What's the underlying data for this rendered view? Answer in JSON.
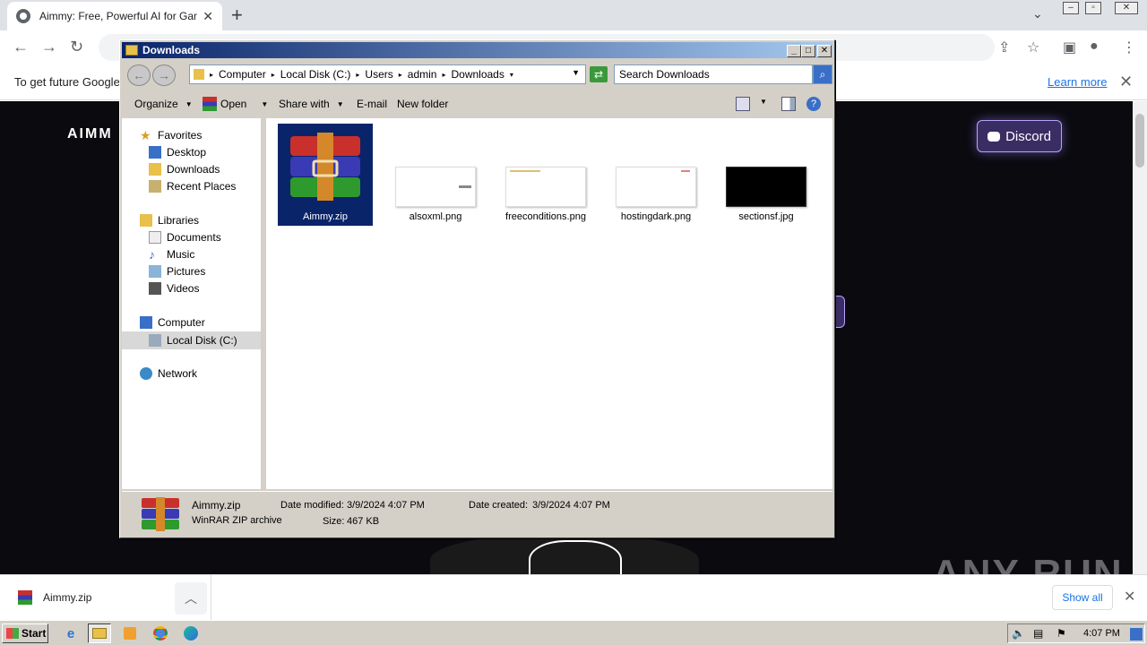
{
  "browser": {
    "tab_title": "Aimmy: Free, Powerful AI for Gaming",
    "infobar_text": "To get future Google",
    "learn_more": "Learn more"
  },
  "webpage": {
    "logo": "AIMM",
    "discord_label": "Discord",
    "watermark": "ANY RUN"
  },
  "download_shelf": {
    "file_name": "Aimmy.zip",
    "show_all": "Show all"
  },
  "taskbar": {
    "start_label": "Start",
    "clock": "4:07 PM"
  },
  "explorer": {
    "title": "Downloads",
    "breadcrumbs": [
      "Computer",
      "Local Disk (C:)",
      "Users",
      "admin",
      "Downloads"
    ],
    "search_placeholder": "Search Downloads",
    "commands": {
      "organize": "Organize",
      "open": "Open",
      "share_with": "Share with",
      "email": "E-mail",
      "new_folder": "New folder"
    },
    "nav": {
      "favorites": "Favorites",
      "desktop": "Desktop",
      "downloads": "Downloads",
      "recent_places": "Recent Places",
      "libraries": "Libraries",
      "documents": "Documents",
      "music": "Music",
      "pictures": "Pictures",
      "videos": "Videos",
      "computer": "Computer",
      "local_disk": "Local Disk (C:)",
      "network": "Network"
    },
    "files": [
      {
        "name": "Aimmy.zip",
        "selected": true
      },
      {
        "name": "alsoxml.png"
      },
      {
        "name": "freeconditions.png"
      },
      {
        "name": "hostingdark.png"
      },
      {
        "name": "sectionsf.jpg"
      }
    ],
    "details": {
      "name": "Aimmy.zip",
      "type": "WinRAR ZIP archive",
      "date_modified_label": "Date modified:",
      "date_modified": "3/9/2024 4:07 PM",
      "date_created_label": "Date created:",
      "date_created": "3/9/2024 4:07 PM",
      "size_label": "Size:",
      "size": "467 KB"
    }
  },
  "colors": {
    "titlebar_start": "#0a246a",
    "titlebar_end": "#a6caf0",
    "discord_border": "#b9a2ff",
    "link_blue": "#1a73e8"
  }
}
